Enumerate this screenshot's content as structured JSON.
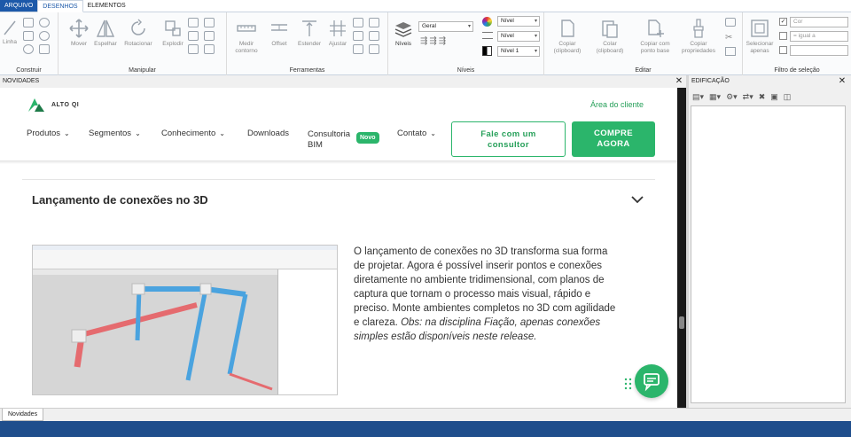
{
  "ribbon": {
    "tabs": [
      {
        "label": "ARQUIVO"
      },
      {
        "label": "DESENHOS"
      },
      {
        "label": "ELEMENTOS"
      }
    ],
    "groups": {
      "construir": {
        "name": "Construir",
        "buttons": [
          {
            "label": "Linha"
          }
        ]
      },
      "manipular": {
        "name": "Manipular",
        "buttons": [
          {
            "label": "Mover"
          },
          {
            "label": "Espelhar"
          },
          {
            "label": "Rotacionar"
          },
          {
            "label": "Explodir"
          }
        ]
      },
      "ferramentas": {
        "name": "Ferramentas",
        "buttons": [
          {
            "label": "Medir contorno"
          },
          {
            "label": "Offset"
          },
          {
            "label": "Estender"
          },
          {
            "label": "Ajustar"
          }
        ]
      },
      "niveis": {
        "name": "Níveis",
        "button": "Níveis",
        "combo_geral": "Geral",
        "combo_nivel_1": "Nível",
        "combo_nivel_2": "Nível",
        "combo_nivel_3": "Nível 1"
      },
      "editar": {
        "name": "Editar",
        "buttons": [
          {
            "label": "Copiar (clipboard)"
          },
          {
            "label": "Colar (clipboard)"
          },
          {
            "label": "Copiar com ponto base"
          },
          {
            "label": "Copiar propriedades"
          }
        ]
      },
      "filtro": {
        "name": "Filtro de seleção",
        "selecionar": "Selecionar apenas",
        "cor_placeholder": "Cor",
        "igual_placeholder": "= igual a"
      }
    }
  },
  "panels": {
    "novidades_title": "NOVIDADES",
    "close_glyph": "✕",
    "edificacao_title": "EDIFICAÇÃO",
    "edificacao_close": "✕",
    "bottom_tab": "Novidades"
  },
  "site": {
    "logo_text": "ALTO QI",
    "area_cliente": "Área do cliente",
    "nav": [
      {
        "label": "Produtos",
        "chevron": "⌄"
      },
      {
        "label": "Segmentos",
        "chevron": "⌄"
      },
      {
        "label": "Conhecimento",
        "chevron": "⌄"
      },
      {
        "label": "Downloads"
      },
      {
        "label": "Contato",
        "chevron": "⌄"
      }
    ],
    "nav_bim_line1": "Consultoria",
    "nav_bim_line2": "BIM",
    "badge_novo": "Novo",
    "btn_consultor_line1": "Fale com um",
    "btn_consultor_line2": "consultor",
    "btn_compre_line1": "COMPRE",
    "btn_compre_line2": "AGORA",
    "section_title": "Lançamento de conexões no 3D",
    "description": "O lançamento de conexões no 3D transforma sua forma de projetar. Agora é possível inserir pontos e conexões diretamente no ambiente tridimensional, com planos de captura que tornam o processo mais visual, rápido e preciso. Monte ambientes completos no 3D com agilidade e clareza.",
    "description_note": "Obs: na disciplina Fiação, apenas conexões simples estão disponíveis neste release."
  },
  "colors": {
    "brand_green": "#2bb56b",
    "ribbon_blue": "#1c59a9",
    "pipe_blue": "#4aa3df",
    "pipe_red": "#e56b6f"
  }
}
